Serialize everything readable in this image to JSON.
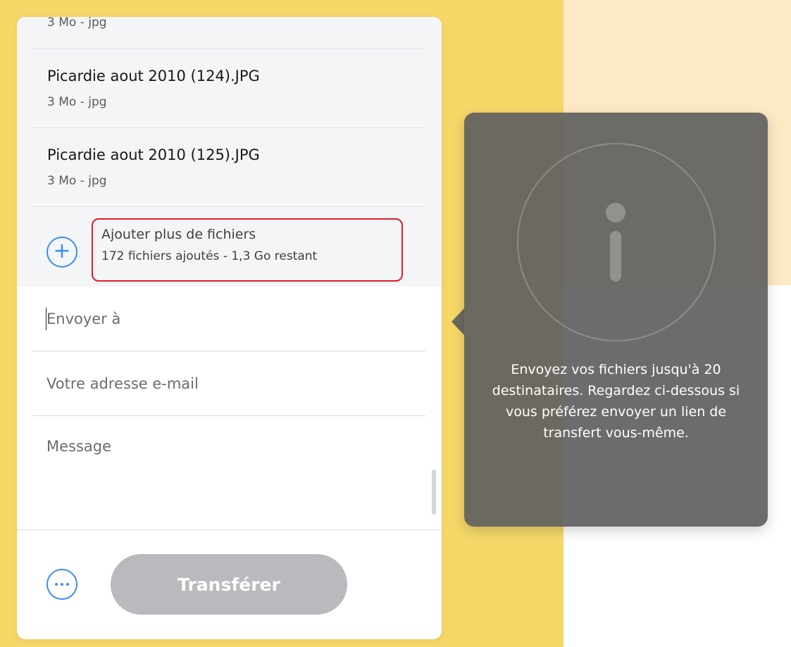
{
  "files": [
    {
      "name": "",
      "meta": "3 Mo - jpg"
    },
    {
      "name": "Picardie aout 2010 (124).JPG",
      "meta": "3 Mo - jpg"
    },
    {
      "name": "Picardie aout 2010 (125).JPG",
      "meta": "3 Mo - jpg"
    }
  ],
  "add_files": {
    "icon": "plus-circle-icon",
    "title": "Ajouter plus de fichiers",
    "subtitle": "172 fichiers ajoutés - 1,3 Go restant"
  },
  "form": {
    "to_placeholder": "Envoyer à",
    "email_placeholder": "Votre adresse e-mail",
    "message_placeholder": "Message"
  },
  "actions": {
    "more_icon": "more-options-icon",
    "transfer_label": "Transférer"
  },
  "tooltip": {
    "icon": "info-icon",
    "text": "Envoyez vos fichiers jusqu'à 20 destinataires. Regardez ci-dessous si vous préférez envoyer un lien de transfert vous-même."
  },
  "colors": {
    "accent": "#3b8df2",
    "highlight": "#e21a2a",
    "background_yellow": "#f6d869",
    "button_disabled": "#b9babd"
  }
}
